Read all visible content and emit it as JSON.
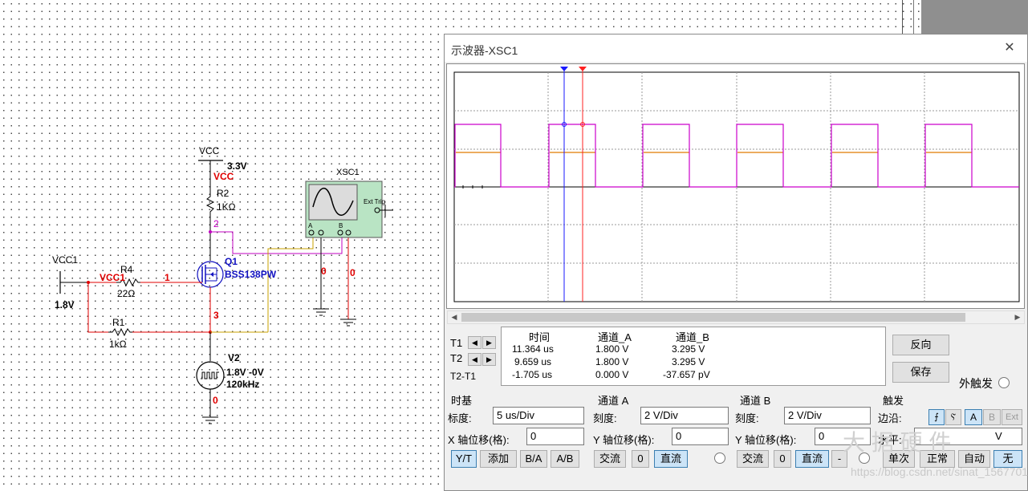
{
  "schematic": {
    "vcc_label": "VCC",
    "vcc_voltage": "3.3V",
    "vcc_net": "VCC",
    "r2_name": "R2",
    "r2_value": "1KΩ",
    "node2": "2",
    "q1_name": "Q1",
    "q1_part": "BSS138PW",
    "node1": "1",
    "node3": "3",
    "vcc1_label": "VCC1",
    "vcc1_voltage": "1.8V",
    "vcc1_net": "VCC1",
    "r4_name": "R4",
    "r4_value": "22Ω",
    "r1_name": "R1",
    "r1_value": "1kΩ",
    "v2_name": "V2",
    "v2_amplitude": "1.8V -0V",
    "v2_freq": "120kHz",
    "node0_gnd": "0",
    "xsc_name": "XSC1",
    "xsc_ext": "Ext Trig",
    "xsc_a": "A",
    "xsc_b": "B",
    "node0_a": "0",
    "node0_b": "0"
  },
  "scope": {
    "title": "示波器-XSC1",
    "close": "✕",
    "readout": {
      "headers": [
        "时间",
        "通道_A",
        "通道_B"
      ],
      "rows": [
        {
          "label": "T1",
          "time": "11.364 us",
          "a": "1.800 V",
          "b": "3.295 V"
        },
        {
          "label": "T2",
          "time": "9.659 us",
          "a": "1.800 V",
          "b": "3.295 V"
        },
        {
          "label": "T2-T1",
          "time": "-1.705 us",
          "a": "0.000 V",
          "b": "-37.657 pV"
        }
      ]
    },
    "reverse_btn": "反向",
    "save_btn": "保存",
    "ext_trigger": "外触发",
    "timebase": {
      "title": "时基",
      "scale_label": "标度:",
      "scale_value": "5 us/Div",
      "xpos_label": "X 轴位移(格):",
      "xpos_value": "0",
      "buttons": [
        "Y/T",
        "添加",
        "B/A",
        "A/B"
      ]
    },
    "channel_a": {
      "title": "通道 A",
      "scale_label": "刻度:",
      "scale_value": "2  V/Div",
      "ypos_label": "Y 轴位移(格):",
      "ypos_value": "0",
      "buttons": [
        "交流",
        "0",
        "直流"
      ]
    },
    "channel_b": {
      "title": "通道 B",
      "scale_label": "刻度:",
      "scale_value": "2  V/Div",
      "ypos_label": "Y 轴位移(格):",
      "ypos_value": "0",
      "buttons": [
        "交流",
        "0",
        "直流",
        "-"
      ]
    },
    "trigger": {
      "title": "触发",
      "edge_label": "边沿:",
      "edge_buttons": [
        "⨍",
        "Ⲋ",
        "A",
        "B",
        "Ext"
      ],
      "level_label": "水平:",
      "level_unit": "V",
      "mode_buttons": [
        "单次",
        "正常",
        "自动",
        "无"
      ]
    },
    "colors": {
      "channel_a": "#e07a00",
      "channel_b": "#cc00cc",
      "cursor1": "#1a1aff",
      "cursor2": "#ff2020"
    }
  },
  "watermark": {
    "logo": "大 据 硬 件",
    "text": "https://blog.csdn.net/sinat_15677011"
  }
}
